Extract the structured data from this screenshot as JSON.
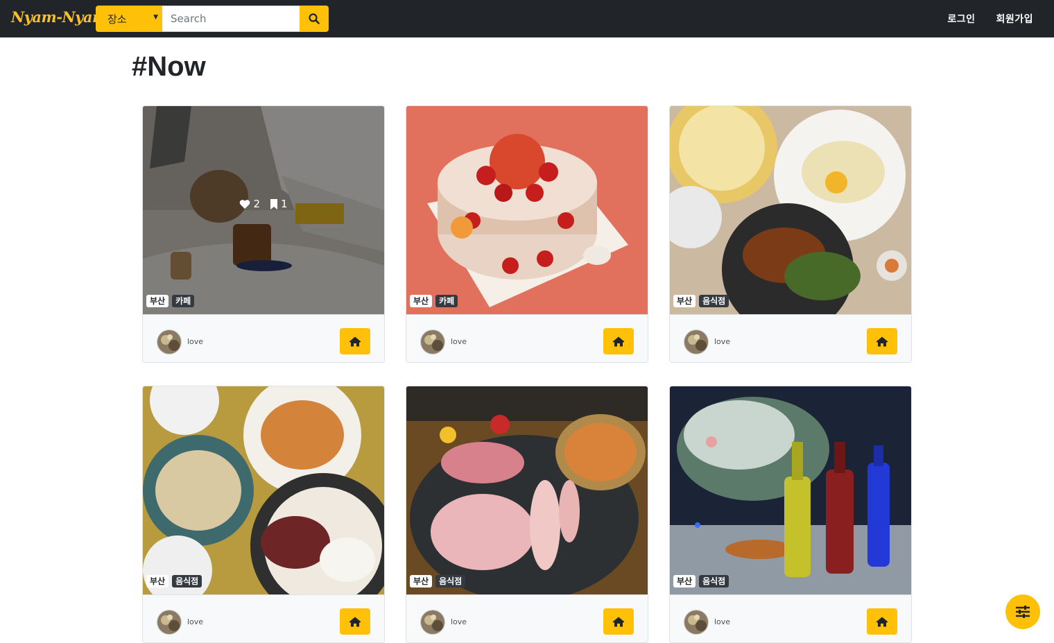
{
  "navbar": {
    "brand": "Nyam-Nyam",
    "place_select": "장소",
    "search_placeholder": "Search",
    "login": "로그인",
    "signup": "회원가입"
  },
  "page_title": "#Now",
  "cards": [
    {
      "region": "부산",
      "category": "카페",
      "username": "love",
      "likes": "2",
      "bookmarks": "1"
    },
    {
      "region": "부산",
      "category": "카페",
      "username": "love"
    },
    {
      "region": "부산",
      "category": "음식점",
      "username": "love"
    },
    {
      "region": "부산",
      "category": "음식점",
      "username": "love"
    },
    {
      "region": "부산",
      "category": "음식점",
      "username": "love"
    },
    {
      "region": "부산",
      "category": "음식점",
      "username": "love"
    }
  ],
  "icons": {
    "search": "search-icon",
    "home": "home-icon",
    "heart": "heart-icon",
    "bookmark": "bookmark-icon",
    "filter": "sliders-icon"
  },
  "colors": {
    "navbar_bg": "#212529",
    "accent": "#ffc107",
    "brand": "#f6c026"
  }
}
